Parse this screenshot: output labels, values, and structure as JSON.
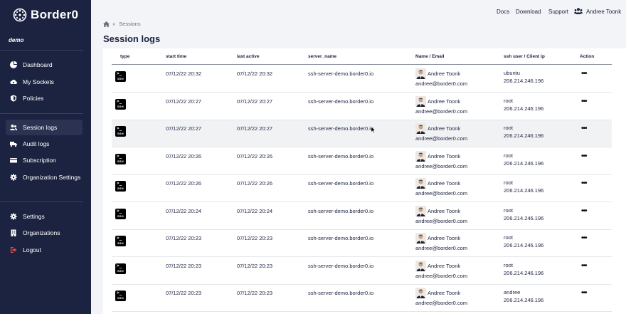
{
  "brand": {
    "name": "Border0"
  },
  "org": {
    "name": "demo"
  },
  "nav": {
    "top": [
      {
        "label": "Dashboard",
        "icon": "pie-chart-icon"
      },
      {
        "label": "My Sockets",
        "icon": "cloud-upload-icon"
      },
      {
        "label": "Policies",
        "icon": "shield-icon"
      }
    ],
    "middle": [
      {
        "label": "Session logs",
        "icon": "users-icon",
        "active": true
      },
      {
        "label": "Audit logs",
        "icon": "truck-icon"
      },
      {
        "label": "Subscription",
        "icon": "credit-card-icon"
      },
      {
        "label": "Organization Settings",
        "icon": "gear-icon"
      }
    ],
    "bottom": [
      {
        "label": "Settings",
        "icon": "gear-icon"
      },
      {
        "label": "Organizations",
        "icon": "building-icon"
      },
      {
        "label": "Logout",
        "icon": "logout-icon"
      }
    ]
  },
  "topbar": {
    "docs": "Docs",
    "download": "Download",
    "support": "Support",
    "user": "Andree Toonk"
  },
  "breadcrumb": {
    "separator": "»",
    "current": "Sessions"
  },
  "page": {
    "title": "Session logs"
  },
  "table": {
    "columns": [
      "type",
      "start time",
      "last active",
      "server_name",
      "Name / Email",
      "ssh user / Client ip",
      "Action"
    ],
    "rows": [
      {
        "type": "SSH",
        "start": "07/12/22 20:32",
        "last": "07/12/22 20:32",
        "server": "ssh-server-demo.border0.io",
        "name": "Andree Toonk",
        "email": "andree@border0.com",
        "user": "ubuntu",
        "ip": "206.214.246.196",
        "action": "•••"
      },
      {
        "type": "SSH",
        "start": "07/12/22 20:27",
        "last": "07/12/22 20:27",
        "server": "ssh-server-demo.border0.io",
        "name": "Andree Toonk",
        "email": "andree@border0.com",
        "user": "root",
        "ip": "206.214.246.196",
        "action": "•••"
      },
      {
        "type": "SSH",
        "start": "07/12/22 20:27",
        "last": "07/12/22 20:27",
        "server": "ssh-server-demo.border0.io",
        "name": "Andree Toonk",
        "email": "andree@border0.com",
        "user": "root",
        "ip": "206.214.246.196",
        "action": "•••"
      },
      {
        "type": "SSH",
        "start": "07/12/22 20:26",
        "last": "07/12/22 20:26",
        "server": "ssh-server-demo.border0.io",
        "name": "Andree Toonk",
        "email": "andree@border0.com",
        "user": "root",
        "ip": "206.214.246.196",
        "action": "•••"
      },
      {
        "type": "SSH",
        "start": "07/12/22 20:26",
        "last": "07/12/22 20:26",
        "server": "ssh-server-demo.border0.io",
        "name": "Andree Toonk",
        "email": "andree@border0.com",
        "user": "root",
        "ip": "206.214.246.196",
        "action": "•••"
      },
      {
        "type": "SSH",
        "start": "07/12/22 20:24",
        "last": "07/12/22 20:24",
        "server": "ssh-server-demo.border0.io",
        "name": "Andree Toonk",
        "email": "andree@border0.com",
        "user": "root",
        "ip": "206.214.246.196",
        "action": "•••"
      },
      {
        "type": "SSH",
        "start": "07/12/22 20:23",
        "last": "07/12/22 20:23",
        "server": "ssh-server-demo.border0.io",
        "name": "Andree Toonk",
        "email": "andree@border0.com",
        "user": "root",
        "ip": "206.214.246.196",
        "action": "•••"
      },
      {
        "type": "SSH",
        "start": "07/12/22 20:23",
        "last": "07/12/22 20:23",
        "server": "ssh-server-demo.border0.io",
        "name": "Andree Toonk",
        "email": "andree@border0.com",
        "user": "root",
        "ip": "206.214.246.196",
        "action": "•••"
      },
      {
        "type": "SSH",
        "start": "07/12/22 20:23",
        "last": "07/12/22 20:23",
        "server": "ssh-server-demo.border0.io",
        "name": "Andree Toonk",
        "email": "andree@border0.com",
        "user": "andree",
        "ip": "206.214.246.196",
        "action": "•••"
      }
    ]
  },
  "colors": {
    "sidebar": "#1c2340",
    "accent": "#1c2340",
    "logout": "#e5484d"
  }
}
